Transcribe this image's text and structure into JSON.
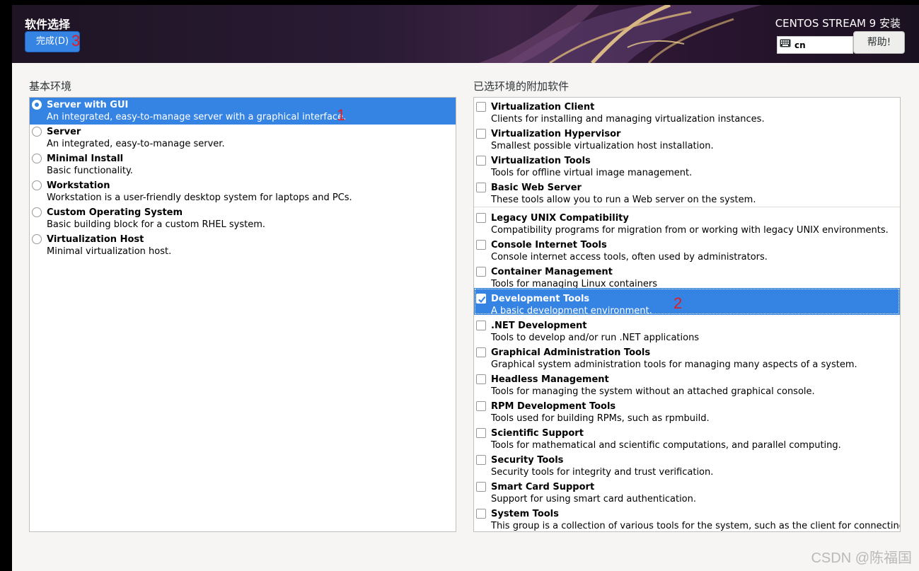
{
  "header": {
    "title": "软件选择",
    "done_label": "完成(D)",
    "product": "CENTOS STREAM 9 安装",
    "keyboard_layout": "cn",
    "help_label": "帮助!"
  },
  "annotations": [
    "1",
    "2",
    "3"
  ],
  "left": {
    "title": "基本环境",
    "items": [
      {
        "name": "Server with GUI",
        "desc": "An integrated, easy-to-manage server with a graphical interface.",
        "selected": true
      },
      {
        "name": "Server",
        "desc": "An integrated, easy-to-manage server.",
        "selected": false
      },
      {
        "name": "Minimal Install",
        "desc": "Basic functionality.",
        "selected": false
      },
      {
        "name": "Workstation",
        "desc": "Workstation is a user-friendly desktop system for laptops and PCs.",
        "selected": false
      },
      {
        "name": "Custom Operating System",
        "desc": "Basic building block for a custom RHEL system.",
        "selected": false
      },
      {
        "name": "Virtualization Host",
        "desc": "Minimal virtualization host.",
        "selected": false
      }
    ]
  },
  "right": {
    "title": "已选环境的附加软件",
    "items": [
      {
        "name": "Virtualization Client",
        "desc": "Clients for installing and managing virtualization instances.",
        "checked": false
      },
      {
        "name": "Virtualization Hypervisor",
        "desc": "Smallest possible virtualization host installation.",
        "checked": false
      },
      {
        "name": "Virtualization Tools",
        "desc": "Tools for offline virtual image management.",
        "checked": false
      },
      {
        "name": "Basic Web Server",
        "desc": "These tools allow you to run a Web server on the system.",
        "checked": false
      },
      {
        "name": "Legacy UNIX Compatibility",
        "desc": "Compatibility programs for migration from or working with legacy UNIX environments.",
        "checked": false
      },
      {
        "name": "Console Internet Tools",
        "desc": "Console internet access tools, often used by administrators.",
        "checked": false
      },
      {
        "name": "Container Management",
        "desc": "Tools for managing Linux containers",
        "checked": false
      },
      {
        "name": "Development Tools",
        "desc": "A basic development environment.",
        "checked": true
      },
      {
        "name": ".NET Development",
        "desc": "Tools to develop and/or run .NET applications",
        "checked": false
      },
      {
        "name": "Graphical Administration Tools",
        "desc": "Graphical system administration tools for managing many aspects of a system.",
        "checked": false
      },
      {
        "name": "Headless Management",
        "desc": "Tools for managing the system without an attached graphical console.",
        "checked": false
      },
      {
        "name": "RPM Development Tools",
        "desc": "Tools used for building RPMs, such as rpmbuild.",
        "checked": false
      },
      {
        "name": "Scientific Support",
        "desc": "Tools for mathematical and scientific computations, and parallel computing.",
        "checked": false
      },
      {
        "name": "Security Tools",
        "desc": "Security tools for integrity and trust verification.",
        "checked": false
      },
      {
        "name": "Smart Card Support",
        "desc": "Support for using smart card authentication.",
        "checked": false
      },
      {
        "name": "System Tools",
        "desc": "This group is a collection of various tools for the system, such as the client for connecting to",
        "checked": false
      }
    ]
  },
  "watermark": "CSDN @陈福国",
  "colors": {
    "accent": "#3584e4",
    "annotation": "#e01b24"
  }
}
